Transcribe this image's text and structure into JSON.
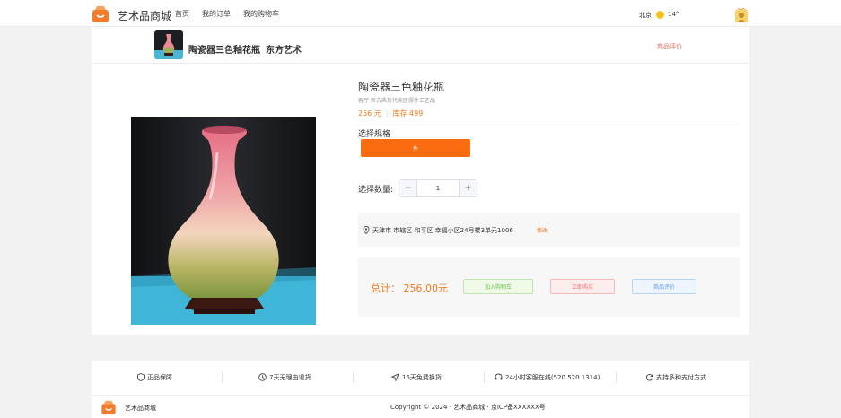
{
  "header": {
    "brand": "艺术品商城",
    "nav": [
      "首页",
      "我的订单",
      "我的购物车"
    ],
    "weather": {
      "city": "北京",
      "temp": "14°"
    }
  },
  "sticky": {
    "product_name": "陶瓷器三色釉花瓶",
    "shop": "东方艺术",
    "review_link": "商品评价"
  },
  "product": {
    "title": "陶瓷器三色釉花瓶",
    "subtitle": "客厅 新古典现代家居摆件工艺品",
    "price": "256 元",
    "stock": "库存 499",
    "spec_label": "选择规格",
    "spec_option": "件",
    "qty_label": "选择数量:",
    "qty_value": "1",
    "minus": "−",
    "plus": "+"
  },
  "address": {
    "text": "天津市 市辖区 和平区 幸福小区24号楼3单元1006",
    "edit": "修改"
  },
  "order": {
    "total": "总计： 256.00元",
    "add_cart": "加入购物车",
    "buy_now": "立即购买",
    "review": "商品评价"
  },
  "footer": {
    "features": [
      "正品保障",
      "7天无理由退货",
      "15天免费换货",
      "24小时客服在线(520 520 1314)",
      "支持多种支付方式"
    ],
    "brand": "艺术品商城",
    "copyright": "Copyright © 2024 · 艺术品商城 · 京ICP备XXXXXX号"
  },
  "colors": {
    "accent": "#fb6b0f",
    "price": "#f57a1f",
    "logo": "#f47b29"
  },
  "icons": [
    "shop-logo-icon",
    "sun-icon",
    "user-avatar-icon",
    "location-pin-icon",
    "shield-icon",
    "clock-icon",
    "send-icon",
    "headset-icon",
    "refresh-icon"
  ]
}
